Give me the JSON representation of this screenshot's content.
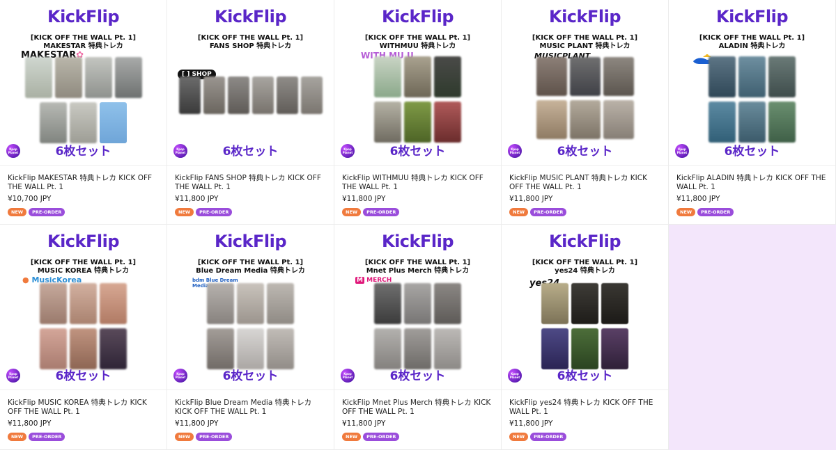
{
  "shared": {
    "brand": "KickFlip",
    "edition": "[KICK OFF THE WALL Pt. 1]",
    "set_label": "6枚セット",
    "badge_text": "Kpop Planet",
    "tag_new": "NEW",
    "tag_preorder": "PRE-ORDER"
  },
  "products": [
    {
      "shop_line": "MAKESTAR 特典トレカ",
      "shop_logo": "MAKESTAR",
      "title": "KickFlip MAKESTAR 特典トレカ KICK OFF THE WALL Pt. 1",
      "price": "¥10,700 JPY"
    },
    {
      "shop_line": "FANS SHOP 特典トレカ",
      "shop_logo": "[ ] SHOP",
      "title": "KickFlip FANS SHOP 特典トレカ KICK OFF THE WALL Pt. 1",
      "price": "¥11,800 JPY"
    },
    {
      "shop_line": "WITHMUU 特典トレカ",
      "shop_logo": "WITH MU U",
      "title": "KickFlip WITHMUU 特典トレカ KICK OFF THE WALL Pt. 1",
      "price": "¥11,800 JPY"
    },
    {
      "shop_line": "MUSIC PLANT 特典トレカ",
      "shop_logo": "MUSICPLANT",
      "title": "KickFlip MUSIC PLANT 特典トレカ KICK OFF THE WALL Pt. 1",
      "price": "¥11,800 JPY"
    },
    {
      "shop_line": "ALADIN 特典トレカ",
      "shop_logo": "",
      "title": "KickFlip ALADIN 特典トレカ KICK OFF THE WALL Pt. 1",
      "price": "¥11,800 JPY"
    },
    {
      "shop_line": "MUSIC KOREA 特典トレカ",
      "shop_logo": "MusicKorea",
      "title": "KickFlip MUSIC KOREA 特典トレカ KICK OFF THE WALL Pt. 1",
      "price": "¥11,800 JPY"
    },
    {
      "shop_line": "Blue Dream Media 特典トレカ",
      "shop_logo": "bdm Blue Dream Media",
      "title": "KickFlip Blue Dream Media 特典トレカ KICK OFF THE WALL Pt. 1",
      "price": "¥11,800 JPY"
    },
    {
      "shop_line": "Mnet Plus Merch 特典トレカ",
      "shop_logo": "MERCH",
      "title": "KickFlip Mnet Plus Merch 特典トレカ KICK OFF THE WALL Pt. 1",
      "price": "¥11,800 JPY"
    },
    {
      "shop_line": "yes24 特典トレカ",
      "shop_logo": "yes24",
      "title": "KickFlip yes24 特典トレカ KICK OFF THE WALL Pt. 1",
      "price": "¥11,800 JPY"
    }
  ]
}
